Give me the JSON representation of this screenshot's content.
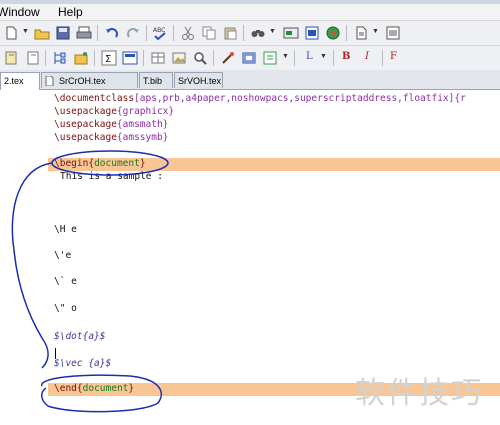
{
  "menu": {
    "window": "Window",
    "help": "Help"
  },
  "tabs": [
    {
      "label": "2.tex",
      "active": true
    },
    {
      "label": "SrCrOH.tex",
      "active": false
    },
    {
      "label": "T.bib",
      "active": false
    },
    {
      "label": "SrVOH.tex",
      "active": false
    }
  ],
  "toolbar2": {
    "format_L": "L",
    "format_B": "B",
    "format_I": "I",
    "format_F": "F"
  },
  "lines": {
    "l1_cmd": "\\documentclass",
    "l1_rest": "[aps,prb,a4paper,noshowpacs,superscriptaddress,floatfix]{r",
    "l2_cmd": "\\usepackage",
    "l2_arg": "{graphicx}",
    "l3_cmd": "\\usepackage",
    "l3_arg": "{amsmath}",
    "l4_cmd": "\\usepackage",
    "l4_arg": "{amssymb}",
    "begin_cmd": "\\begin",
    "begin_brace_open": "{",
    "begin_env": "document",
    "begin_brace_close": "}",
    "sample": "This is a sample :",
    "acc1": "\\H e",
    "acc2": "\\'e",
    "acc3": "\\` e",
    "acc4": "\\\" o",
    "math1": "$\\dot{a}$",
    "math2": "$\\vec {a}$",
    "end_cmd": "\\end",
    "end_brace_open": "{",
    "end_env": "document",
    "end_brace_close": "}"
  },
  "watermark": "软件技巧",
  "colors": {
    "highlight": "#f8c594",
    "annotation": "#1a2fb0"
  }
}
